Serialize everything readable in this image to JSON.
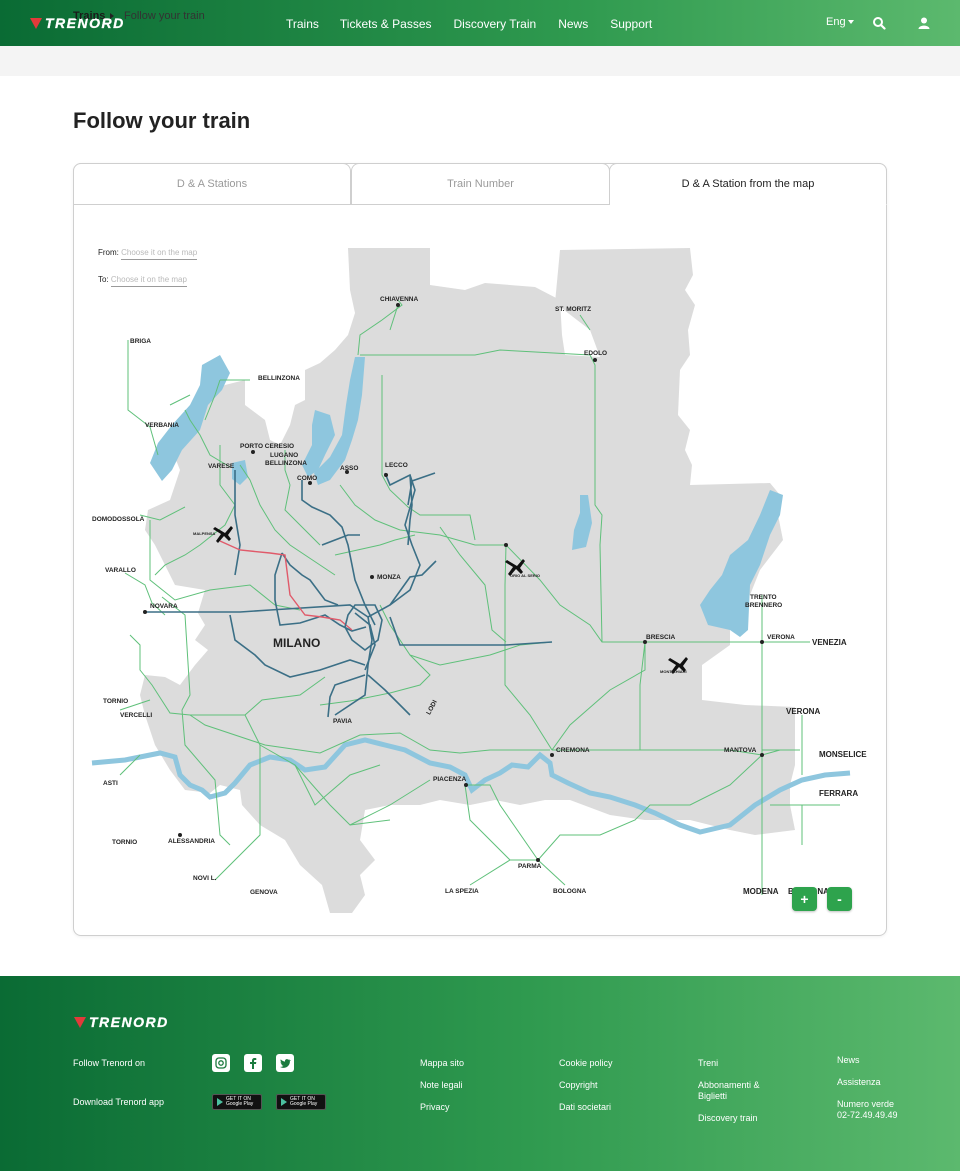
{
  "header": {
    "logo_text": "TRENORD",
    "nav": [
      "Trains",
      "Tickets & Passes",
      "Discovery Train",
      "News",
      "Support"
    ],
    "language": "Eng",
    "icons": [
      "search-icon",
      "user-icon"
    ]
  },
  "breadcrumb": {
    "root": "Trains",
    "current": "Follow your train"
  },
  "page_title": "Follow your train",
  "tabs": [
    {
      "label": "D & A Stations",
      "active": false
    },
    {
      "label": "Train Number",
      "active": false
    },
    {
      "label": "D & A Station from the map",
      "active": true
    }
  ],
  "form": {
    "from_label": "From:",
    "from_placeholder": "Choose it on the map",
    "to_label": "To:",
    "to_placeholder": "Choose it on the map"
  },
  "map": {
    "stations": [
      "CHIAVENNA",
      "ST. MORITZ",
      "EDOLO",
      "BRIGA",
      "BELLINZONA",
      "VERBANIA",
      "PORTO CERESIO",
      "LUGANO",
      "BELLINZONA",
      "VARESE",
      "COMO",
      "ASSO",
      "LECCO",
      "DOMODOSSOLA",
      "MALPENSA",
      "VARALLO",
      "NOVARA",
      "MONZA",
      "ORIO AL SERIO",
      "MILANO",
      "BRESCIA",
      "VERONA",
      "VENEZIA",
      "TRENTO",
      "BRENNERO",
      "MONTICHIARI",
      "TORNIO",
      "VERCELLI",
      "LODI",
      "PAVIA",
      "VERONA",
      "CREMONA",
      "MANTOVA",
      "MONSELICE",
      "ASTI",
      "PIACENZA",
      "FERRARA",
      "TORNIO",
      "ALESSANDRIA",
      "NOVI L.",
      "GENOVA",
      "PARMA",
      "LA SPEZIA",
      "BOLOGNA",
      "MODENA",
      "BOLOGNA"
    ],
    "zoom_in": "+",
    "zoom_out": "-"
  },
  "footer": {
    "logo_text": "TRENORD",
    "follow_label": "Follow Trenord on",
    "download_label": "Download Trenord app",
    "social_icons": [
      "instagram-icon",
      "facebook-icon",
      "twitter-icon"
    ],
    "store_badges": [
      "GET IT ON Google Play",
      "GET IT ON Google Play"
    ],
    "col1": [
      "Mappa sito",
      "Note legali",
      "Privacy"
    ],
    "col2": [
      "Cookie policy",
      "Copyright",
      "Dati societari"
    ],
    "col3": [
      "Treni",
      "Abbonamenti & Biglietti",
      "Discovery train"
    ],
    "col4": [
      "News",
      "Assistenza",
      "Numero verde 02-72.49.49.49"
    ]
  }
}
